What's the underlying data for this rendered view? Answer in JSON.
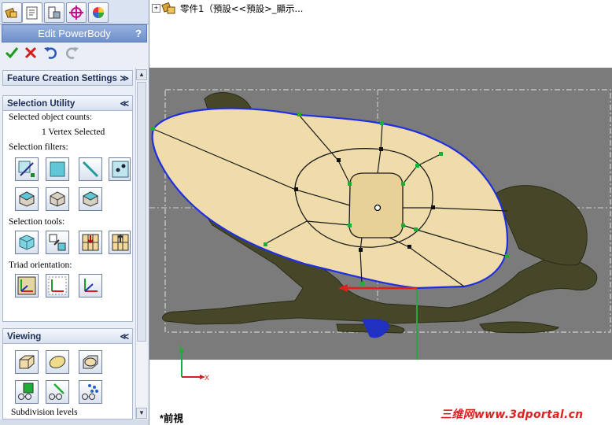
{
  "manager_tabs": [
    "feature-manager",
    "property-manager",
    "configuration-manager",
    "dimxpert-manager",
    "display-manager"
  ],
  "property_manager": {
    "title": "Edit PowerBody",
    "help": "?",
    "actions": [
      "ok",
      "cancel",
      "undo",
      "redo"
    ]
  },
  "feature_creation": {
    "label": "Feature Creation Settings",
    "chevron": "≫"
  },
  "selection_utility": {
    "label": "Selection Utility",
    "chevron": "≪",
    "counts_label": "Selected object counts:",
    "count_value": "1 Vertex Selected",
    "filters_label": "Selection filters:",
    "tools_label": "Selection tools:",
    "triad_label": "Triad orientation:"
  },
  "viewing": {
    "label": "Viewing",
    "chevron": "≪",
    "subdivision_label": "Subdivision levels"
  },
  "tree": {
    "label": "零件1（預設<<預設>_顯示..."
  },
  "view_name": "*前視",
  "watermark": "三维网www.3dportal.cn",
  "colors": {
    "body_fill": "#efdcaa",
    "frog": "#464629",
    "cage": "#1a1a1a",
    "outline": "#1f2ee0",
    "vertex": "#1fae35",
    "scene_bg": "#7b7b7b",
    "title_bar": "#7f9dd4"
  }
}
